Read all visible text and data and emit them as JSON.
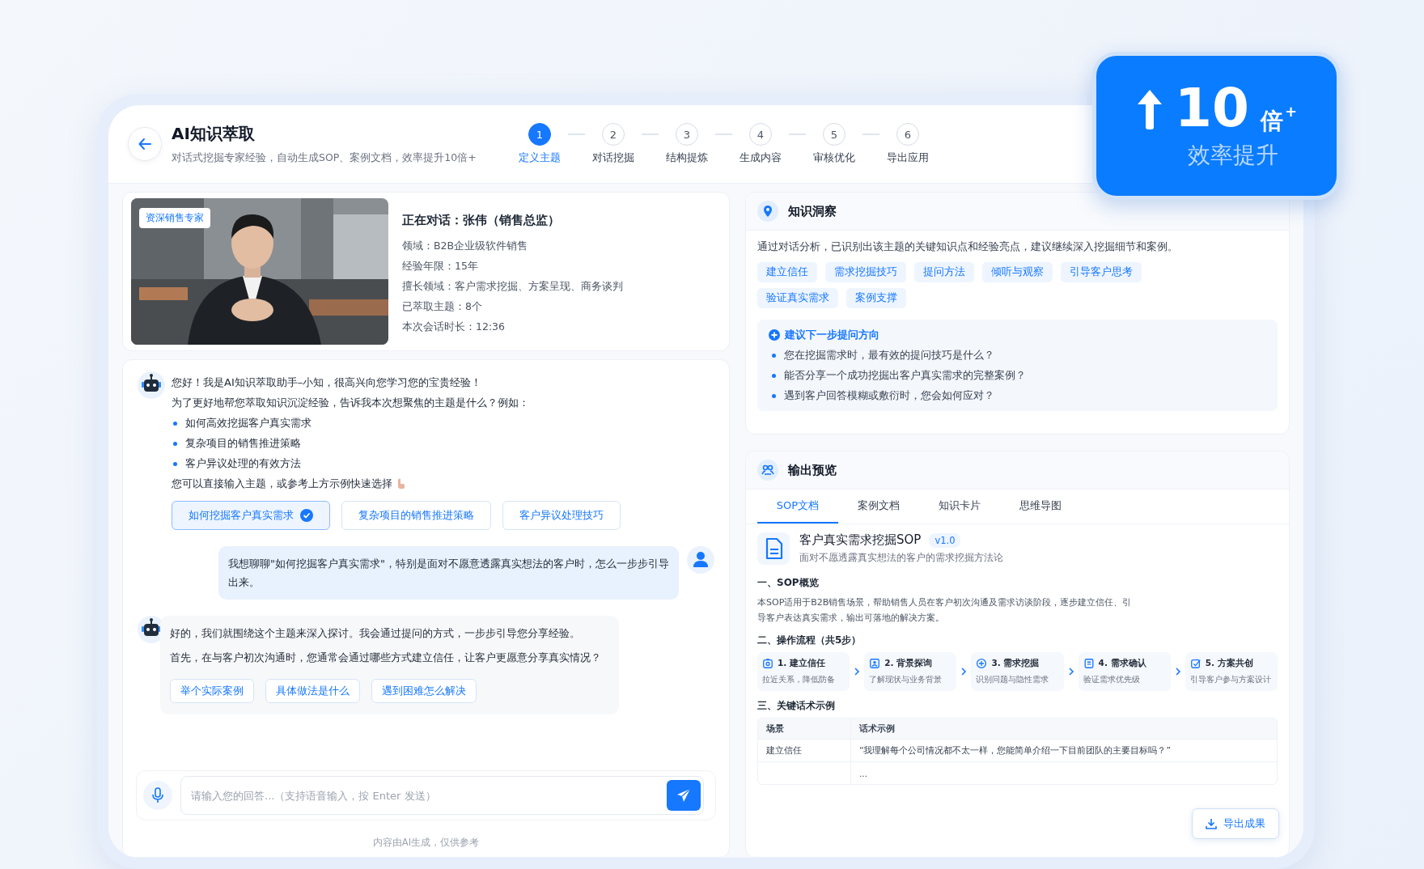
{
  "header": {
    "title": "AI知识萃取",
    "subtitle": "对话式挖掘专家经验，自动生成SOP、案例文档，效率提升10倍+"
  },
  "steps": [
    {
      "number": "1",
      "label": "定义主题",
      "selected": true
    },
    {
      "number": "2",
      "label": "对话挖掘",
      "selected": false
    },
    {
      "number": "3",
      "label": "结构提炼",
      "selected": false
    },
    {
      "number": "4",
      "label": "生成内容",
      "selected": false
    },
    {
      "number": "5",
      "label": "审核优化",
      "selected": false
    },
    {
      "number": "6",
      "label": "导出应用",
      "selected": false
    }
  ],
  "badge": {
    "number": "10",
    "unit": "倍",
    "plus": "+",
    "caption": "效率提升"
  },
  "profile": {
    "tag": "资深销售专家",
    "title": "正在对话：张伟（销售总监）",
    "details": [
      "领域：B2B企业级软件销售",
      "经验年限：15年",
      "擅长领域：客户需求挖掘、方案呈现、商务谈判",
      "已萃取主题：8个",
      "本次会话时长：12:36"
    ]
  },
  "chat": {
    "messages": [
      {
        "kind": "bot",
        "paragraphs": [
          "您好！我是AI知识萃取助手–小知，很高兴向您学习您的宝贵经验！",
          "为了更好地帮您萃取知识沉淀经验，告诉我本次想聚焦的主题是什么？例如："
        ],
        "bullets": [
          "如何高效挖掘客户真实需求",
          "复杂项目的销售推进策略",
          "客户异议处理的有效方法"
        ],
        "closing": "您可以直接输入主题，或参考上方示例快速选择",
        "options": [
          {
            "label": "如何挖掘客户真实需求",
            "selected": true
          },
          {
            "label": "复杂项目的销售推进策略",
            "selected": false
          },
          {
            "label": "客户异议处理技巧",
            "selected": false
          }
        ]
      },
      {
        "kind": "user",
        "text": "我想聊聊\"如何挖掘客户真实需求\"，特别是面对不愿意透露真实想法的客户时，怎么一步步引导出来。"
      },
      {
        "kind": "bot",
        "paragraphs": [
          "好的，我们就围绕这个主题来深入探讨。我会通过提问的方式，一步步引导您分享经验。",
          "首先，在与客户初次沟通时，您通常会通过哪些方式建立信任，让客户更愿意分享真实情况？"
        ],
        "options": [
          {
            "label": "举个实际案例",
            "selected": false
          },
          {
            "label": "具体做法是什么",
            "selected": false
          },
          {
            "label": "遇到困难怎么解决",
            "selected": false
          }
        ]
      }
    ],
    "input": {
      "placeholder": "请输入您的回答...（支持语音输入，按 Enter 发送）"
    },
    "note": "内容由AI生成，仅供参考"
  },
  "insight": {
    "title": "知识洞察",
    "description": "通过对话分析，已识别出该主题的关键知识点和经验亮点，建议继续深入挖掘细节和案例。",
    "tags": [
      "建立信任",
      "需求挖掘技巧",
      "提问方法",
      "倾听与观察",
      "引导客户思考",
      "验证真实需求",
      "案例支撑"
    ],
    "suggestion": {
      "title": "建议下一步提问方向",
      "questions": [
        "您在挖掘需求时，最有效的提问技巧是什么？",
        "能否分享一个成功挖掘出客户真实需求的完整案例？",
        "遇到客户回答模糊或敷衍时，您会如何应对？"
      ]
    }
  },
  "output": {
    "title": "输出预览",
    "tabs": [
      {
        "label": "SOP文档",
        "selected": true
      },
      {
        "label": "案例文档",
        "selected": false
      },
      {
        "label": "知识卡片",
        "selected": false
      },
      {
        "label": "思维导图",
        "selected": false
      }
    ],
    "doc": {
      "title": "客户真实需求挖掘SOP",
      "version": "v1.0",
      "subtitle": "面对不愿透露真实想法的客户的需求挖掘方法论",
      "overview_heading": "一、SOP概览",
      "overview": "本SOP适用于B2B销售场景，帮助销售人员在客户初次沟通及需求访谈阶段，逐步建立信任、引导客户表达真实需求，输出可落地的解决方案。",
      "flow_heading": "二、操作流程（共5步）",
      "flow": [
        {
          "title": "1. 建立信任",
          "desc": "拉近关系，降低防备"
        },
        {
          "title": "2. 背景探询",
          "desc": "了解现状与业务背景"
        },
        {
          "title": "3. 需求挖掘",
          "desc": "识别问题与隐性需求"
        },
        {
          "title": "4. 需求确认",
          "desc": "验证需求优先级"
        },
        {
          "title": "5. 方案共创",
          "desc": "引导客户参与方案设计"
        }
      ],
      "examples_heading": "三、关键话术示例",
      "columns": [
        "场景",
        "话术示例"
      ],
      "rows": [
        {
          "scene": "建立信任",
          "example": "“我理解每个公司情况都不太一样，您能简单介绍一下目前团队的主要目标吗？”"
        },
        {
          "example": "..."
        }
      ]
    },
    "export": "导出成果"
  }
}
